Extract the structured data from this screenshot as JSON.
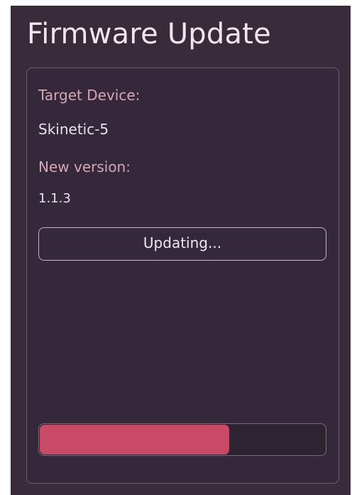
{
  "window": {
    "title": "Firmware Update"
  },
  "device": {
    "label": "Target Device:",
    "value": "Skinetic-5"
  },
  "version": {
    "label": "New version:",
    "value": "1.1.3"
  },
  "update_button": {
    "label": "Updating..."
  },
  "progress": {
    "fraction": 0.665
  },
  "colors": {
    "background": "#3a2b3a",
    "label": "#d7a6b5",
    "text": "#efe6ee",
    "progress_fill": "#c94a68"
  }
}
